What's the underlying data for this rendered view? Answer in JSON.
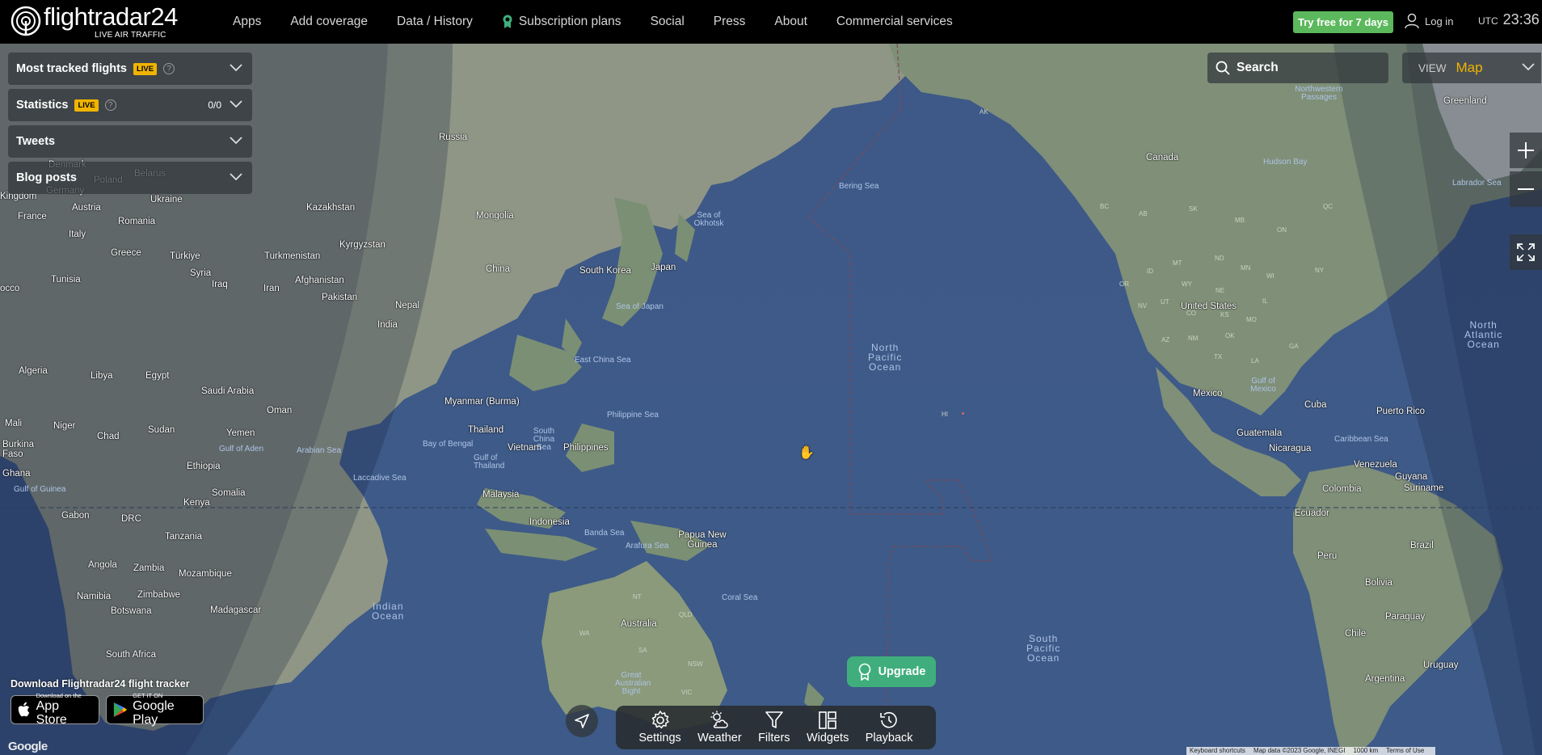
{
  "header": {
    "logo_text": "flightradar",
    "logo_num": "24",
    "logo_sub": "LIVE AIR TRAFFIC",
    "nav": [
      "Apps",
      "Add coverage",
      "Data / History",
      "Subscription plans",
      "Social",
      "Press",
      "About",
      "Commercial services"
    ],
    "trial_label": "Try free for 7 days",
    "login_label": "Log in",
    "utc_label": "UTC",
    "time": "23:36"
  },
  "panels": [
    {
      "title": "Most tracked flights",
      "live": "LIVE",
      "help": "?",
      "count": ""
    },
    {
      "title": "Statistics",
      "live": "LIVE",
      "help": "?",
      "count": "0/0"
    },
    {
      "title": "Tweets",
      "live": "",
      "help": "",
      "count": ""
    },
    {
      "title": "Blog posts",
      "live": "",
      "help": "",
      "count": ""
    }
  ],
  "search": {
    "label": "Search"
  },
  "view": {
    "label": "VIEW",
    "value": "Map"
  },
  "download": {
    "title": "Download Flightradar24 flight tracker",
    "appstore_small": "Download on the",
    "appstore_big": "App Store",
    "googleplay_small": "GET IT ON",
    "googleplay_big": "Google Play"
  },
  "google_logo": "Google",
  "toolbar": {
    "settings": "Settings",
    "weather": "Weather",
    "filters": "Filters",
    "widgets": "Widgets",
    "playback": "Playback"
  },
  "upgrade_label": "Upgrade",
  "attribution": [
    "Keyboard shortcuts",
    "Map data ©2023 Google, INEGI",
    "1000 km",
    "Terms of Use"
  ],
  "map_labels": {
    "countries": [
      "Russia",
      "Kingdom",
      "Denmark",
      "Poland",
      "Belarus",
      "Germany",
      "Ukraine",
      "Austria",
      "France",
      "Romania",
      "Italy",
      "Greece",
      "Türkiye",
      "Kazakhstan",
      "Mongolia",
      "Kyrgyzstan",
      "Turkmenistan",
      "Afghanistan",
      "Tunisia",
      "Syria",
      "Iraq",
      "Iran",
      "Pakistan",
      "Nepal",
      "China",
      "South Korea",
      "Japan",
      "India",
      "Algeria",
      "Libya",
      "Egypt",
      "Saudi Arabia",
      "Oman",
      "Myanmar (Burma)",
      "Thailand",
      "Vietnam",
      "Philippines",
      "Mali",
      "Niger",
      "Chad",
      "Sudan",
      "Yemen",
      "Burkina Faso",
      "Ghana",
      "Ethiopia",
      "Somalia",
      "Malaysia",
      "Indonesia",
      "Papua New Guinea",
      "Gabon",
      "DRC",
      "Kenya",
      "Tanzania",
      "Angola",
      "Zambia",
      "Mozambique",
      "Namibia",
      "Zimbabwe",
      "Botswana",
      "Madagascar",
      "South Africa",
      "Australia",
      "Canada",
      "Greenland",
      "United States",
      "Mexico",
      "Cuba",
      "Puerto Rico",
      "Guatemala",
      "Nicaragua",
      "Venezuela",
      "Guyana",
      "Suriname",
      "Colombia",
      "Ecuador",
      "Peru",
      "Brazil",
      "Bolivia",
      "Paraguay",
      "Chile",
      "Uruguay",
      "Argentina",
      "occo"
    ],
    "seas": [
      "Sea of Okhotsk",
      "Bering Sea",
      "Sea of Japan",
      "East China Sea",
      "Philippine Sea",
      "South China Sea",
      "Bay of Bengal",
      "Gulf of Aden",
      "Arabian Sea",
      "Laccadive Sea",
      "Gulf of Thailand",
      "Gulf of Guinea",
      "Banda Sea",
      "Arafura Sea",
      "Coral Sea",
      "Great Australian Bight",
      "Northwestern Passages",
      "Hudson Bay",
      "Labrador Sea",
      "Gulf of Mexico",
      "Caribbean Sea"
    ],
    "oceans": [
      "North Pacific Ocean",
      "South Pacific Ocean",
      "Indian Ocean",
      "North Atlantic Ocean"
    ],
    "states": [
      "AK",
      "BC",
      "AB",
      "SK",
      "MB",
      "ON",
      "QC",
      "NT",
      "QLD",
      "WA",
      "SA",
      "NSW",
      "VIC",
      "HI",
      "MT",
      "ND",
      "MN",
      "WI",
      "NV",
      "UT",
      "CO",
      "KS",
      "AZ",
      "NM",
      "TX",
      "MO",
      "IL",
      "GA",
      "NY",
      "ID",
      "OR",
      "WY",
      "NE",
      "OK",
      "LA"
    ]
  }
}
